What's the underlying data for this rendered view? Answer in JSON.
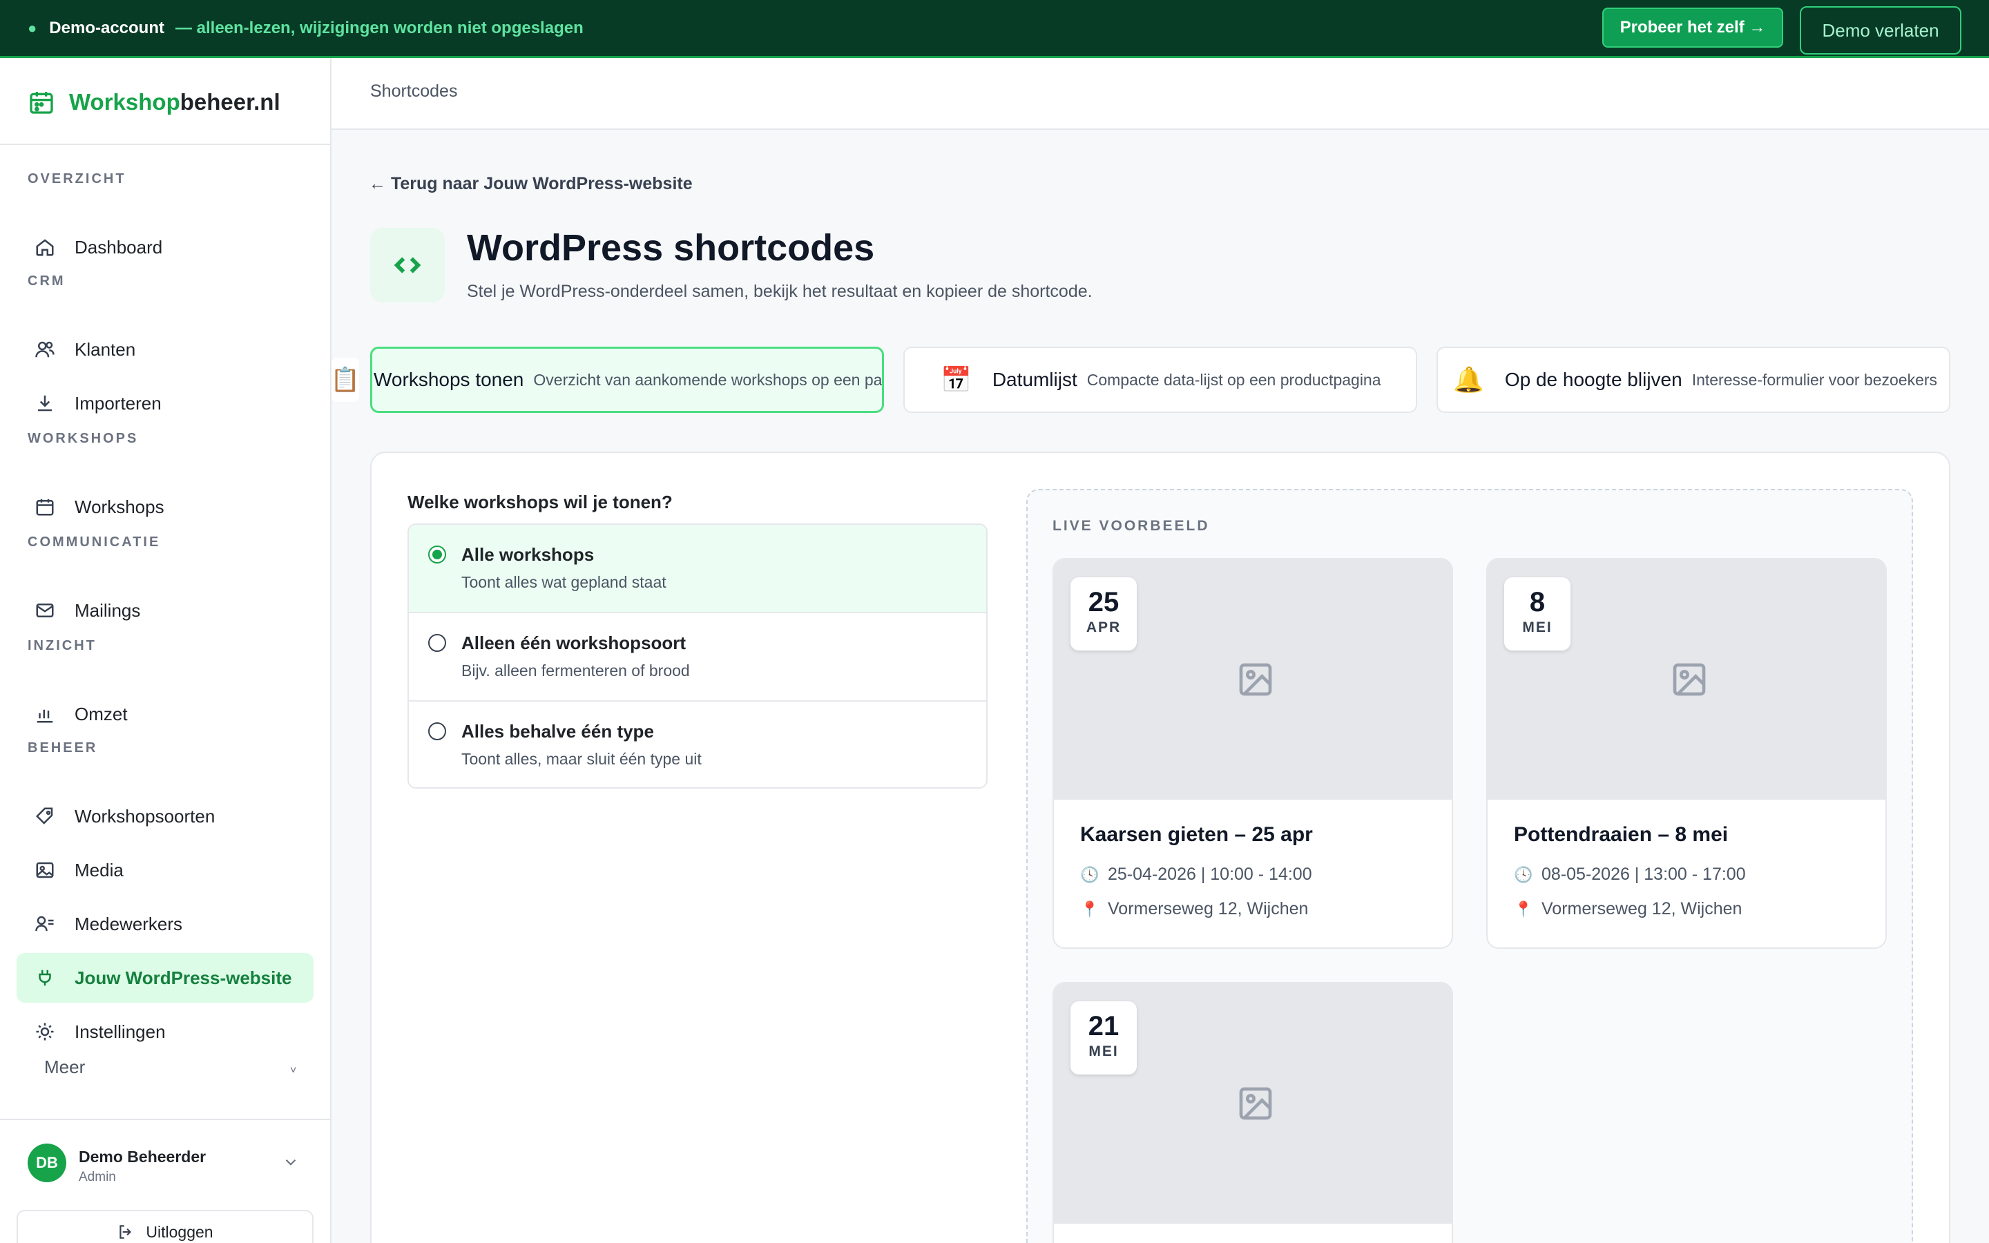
{
  "banner": {
    "account": "Demo-account",
    "note": "— alleen-lezen, wijzigingen worden niet opgeslagen",
    "try_label": "Probeer het zelf →",
    "leave_label": "Demo verlaten"
  },
  "brand": {
    "green": "Workshop",
    "dark": "beheer.nl"
  },
  "sidebar": {
    "sections": {
      "overzicht": "OVERZICHT",
      "crm": "CRM",
      "workshops": "WORKSHOPS",
      "communicatie": "COMMUNICATIE",
      "inzicht": "INZICHT",
      "beheer": "BEHEER"
    },
    "items": {
      "dashboard": "Dashboard",
      "klanten": "Klanten",
      "importeren": "Importeren",
      "workshops": "Workshops",
      "mailings": "Mailings",
      "omzet": "Omzet",
      "workshopsoorten": "Workshopsoorten",
      "media": "Media",
      "medewerkers": "Medewerkers",
      "wordpress": "Jouw WordPress-website",
      "instellingen": "Instellingen"
    },
    "more": "Meer",
    "user": {
      "initials": "DB",
      "name": "Demo Beheerder",
      "role": "Admin"
    },
    "logout": "Uitloggen"
  },
  "breadcrumb": "Shortcodes",
  "back_link": "← Terug naar Jouw WordPress-website",
  "page": {
    "title": "WordPress shortcodes",
    "subtitle": "Stel je WordPress-onderdeel samen, bekijk het resultaat en kopieer de shortcode."
  },
  "tabs": [
    {
      "label": "Workshops tonen",
      "desc": "Overzicht van aankomende workshops op een pagina",
      "icon": "📋"
    },
    {
      "label": "Datumlijst",
      "desc": "Compacte data-lijst op een productpagina",
      "icon": "📅"
    },
    {
      "label": "Op de hoogte blijven",
      "desc": "Interesse-formulier voor bezoekers",
      "icon": "🔔"
    }
  ],
  "question": "Welke workshops wil je tonen?",
  "options": [
    {
      "title": "Alle workshops",
      "desc": "Toont alles wat gepland staat"
    },
    {
      "title": "Alleen één workshopsoort",
      "desc": "Bijv. alleen fermenteren of brood"
    },
    {
      "title": "Alles behalve één type",
      "desc": "Toont alles, maar sluit één type uit"
    }
  ],
  "preview_label": "LIVE VOORBEELD",
  "workshops": [
    {
      "day": "25",
      "month": "APR",
      "title": "Kaarsen gieten – 25 apr",
      "when": "25-04-2026 | 10:00 - 14:00",
      "where": "Vormerseweg 12, Wijchen"
    },
    {
      "day": "8",
      "month": "MEI",
      "title": "Pottendraaien – 8 mei",
      "when": "08-05-2026 | 13:00 - 17:00",
      "where": "Vormerseweg 12, Wijchen"
    },
    {
      "day": "21",
      "month": "MEI"
    }
  ],
  "colors": {
    "accent": "#16a34a",
    "banner": "#073b25",
    "active_bg": "#dcfce7"
  }
}
